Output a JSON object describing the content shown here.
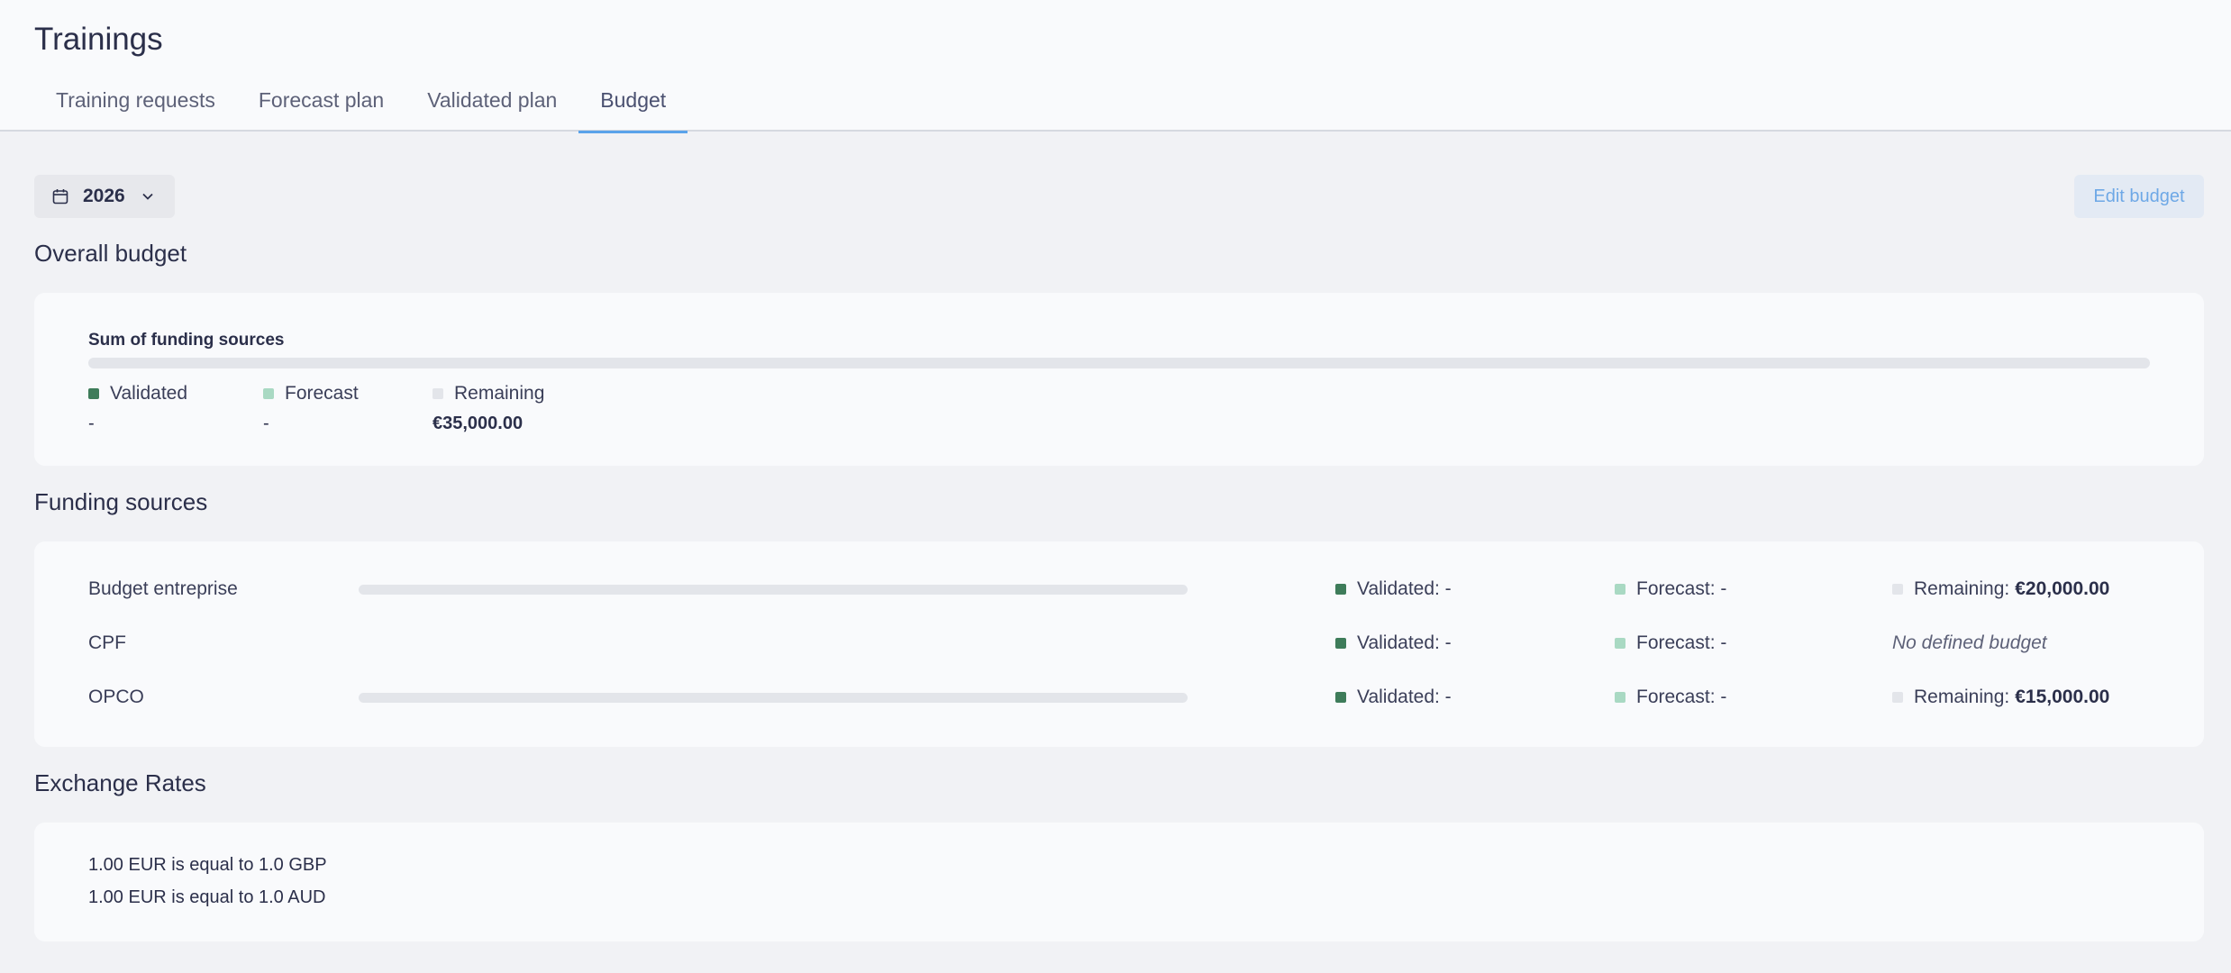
{
  "header": {
    "title": "Trainings",
    "tabs": [
      {
        "label": "Training requests"
      },
      {
        "label": "Forecast plan"
      },
      {
        "label": "Validated plan"
      },
      {
        "label": "Budget"
      }
    ],
    "active_tab": "Budget",
    "accent_color": "#5aa3ea"
  },
  "toolbar": {
    "year": "2026",
    "edit_label": "Edit budget"
  },
  "overall": {
    "title": "Overall budget",
    "sum_label": "Sum of funding sources",
    "legend": {
      "validated_label": "Validated",
      "validated_value": "-",
      "forecast_label": "Forecast",
      "forecast_value": "-",
      "remaining_label": "Remaining",
      "remaining_value": "€35,000.00"
    }
  },
  "funding": {
    "title": "Funding sources",
    "rows": [
      {
        "name": "Budget entreprise",
        "validated": "Validated: -",
        "forecast": "Forecast: -",
        "remaining_label": "Remaining:",
        "remaining_value": "€20,000.00"
      },
      {
        "name": "CPF",
        "validated": "Validated: -",
        "forecast": "Forecast: -",
        "no_budget": "No defined budget"
      },
      {
        "name": "OPCO",
        "validated": "Validated: -",
        "forecast": "Forecast: -",
        "remaining_label": "Remaining:",
        "remaining_value": "€15,000.00"
      }
    ]
  },
  "exchange": {
    "title": "Exchange Rates",
    "rates": [
      "1.00 EUR is equal to 1.0 GBP",
      "1.00 EUR is equal to 1.0 AUD"
    ]
  },
  "colors": {
    "validated": "#3e7c5a",
    "forecast": "#a9d9c3",
    "remaining": "#e3e5ea"
  }
}
